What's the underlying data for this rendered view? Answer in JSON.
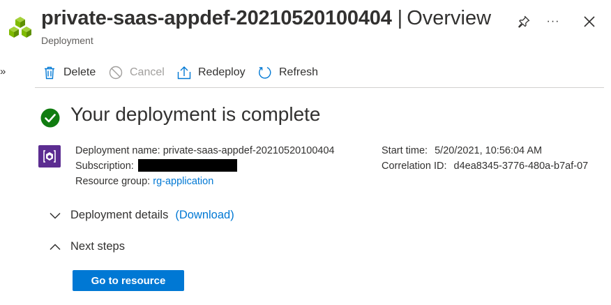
{
  "header": {
    "title": "private-saas-appdef-20210520100404",
    "separator": "|",
    "view": "Overview",
    "subtitle": "Deployment",
    "more_label": "···",
    "expand_label": "»"
  },
  "toolbar": {
    "delete_label": "Delete",
    "cancel_label": "Cancel",
    "redeploy_label": "Redeploy",
    "refresh_label": "Refresh"
  },
  "status": {
    "title": "Your deployment is complete"
  },
  "details": {
    "deployment_name_label": "Deployment name:",
    "deployment_name_value": "private-saas-appdef-20210520100404",
    "subscription_label": "Subscription:",
    "resource_group_label": "Resource group:",
    "resource_group_value": "rg-application",
    "start_time_label": "Start time:",
    "start_time_value": "5/20/2021, 10:56:04 AM",
    "correlation_id_label": "Correlation ID:",
    "correlation_id_value": "d4ea8345-3776-480a-b7af-07"
  },
  "sections": {
    "deployment_details_label": "Deployment details",
    "download_label": "(Download)",
    "next_steps_label": "Next steps"
  },
  "actions": {
    "go_to_resource_label": "Go to resource"
  },
  "colors": {
    "accent": "#0078d4",
    "success": "#107c10",
    "deployment_icon": "#5c2d91",
    "resource_icon": "#7fba00"
  }
}
